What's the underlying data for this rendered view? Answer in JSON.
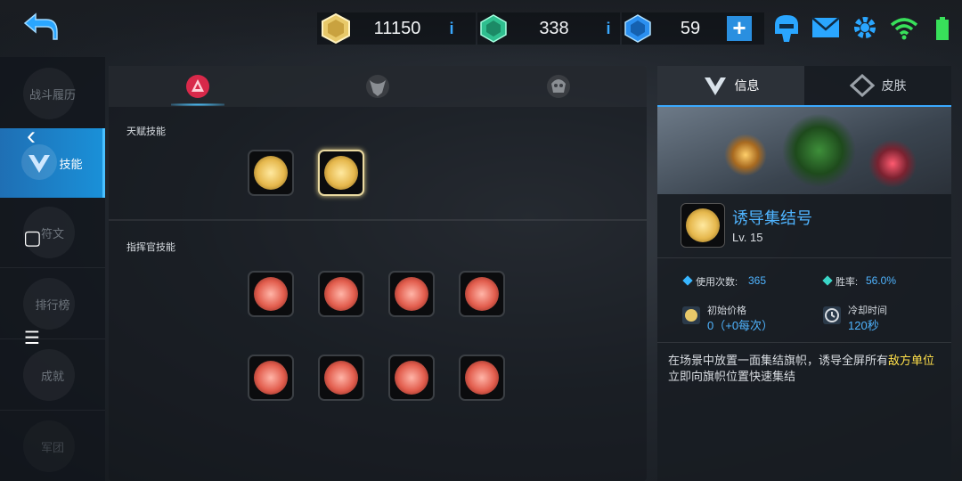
{
  "resources": {
    "gold": {
      "value": "11150",
      "info": "i"
    },
    "green_crystal": {
      "value": "338",
      "info": "i"
    },
    "blue_crystal": {
      "value": "59",
      "add": "+"
    }
  },
  "left_menu": {
    "items": [
      {
        "label": "战斗履历"
      },
      {
        "label": "技能"
      },
      {
        "label": "符文"
      },
      {
        "label": "排行榜"
      },
      {
        "label": "成就"
      },
      {
        "label": "军团"
      }
    ]
  },
  "skill_panel": {
    "talent_label": "天赋技能",
    "commander_label": "指挥官技能"
  },
  "info_panel": {
    "tabs": [
      "信息",
      "皮肤"
    ],
    "skill_name": "诱导集结号",
    "level": "Lv. 15",
    "uses_label": "使用次数:",
    "uses_value": "365",
    "winrate_label": "胜率:",
    "winrate_value": "56.0%",
    "price_label": "初始价格",
    "price_value": "0（+0每次）",
    "cooldown_label": "冷却时间",
    "cooldown_value": "120秒",
    "desc_part1": "在场景中放置一面集结旗帜，诱导全屏所有",
    "desc_highlight1": "敌方",
    "desc_highlight2": "单位",
    "desc_part2": "立即向旗帜位置快速集结"
  },
  "overlay": {
    "back_glyph": "‹",
    "home_glyph": "▢",
    "menu_glyph": "☰"
  },
  "colors": {
    "accent": "#1a90d8",
    "highlight": "#ffe04a",
    "stat_value": "#4fb4ff"
  }
}
